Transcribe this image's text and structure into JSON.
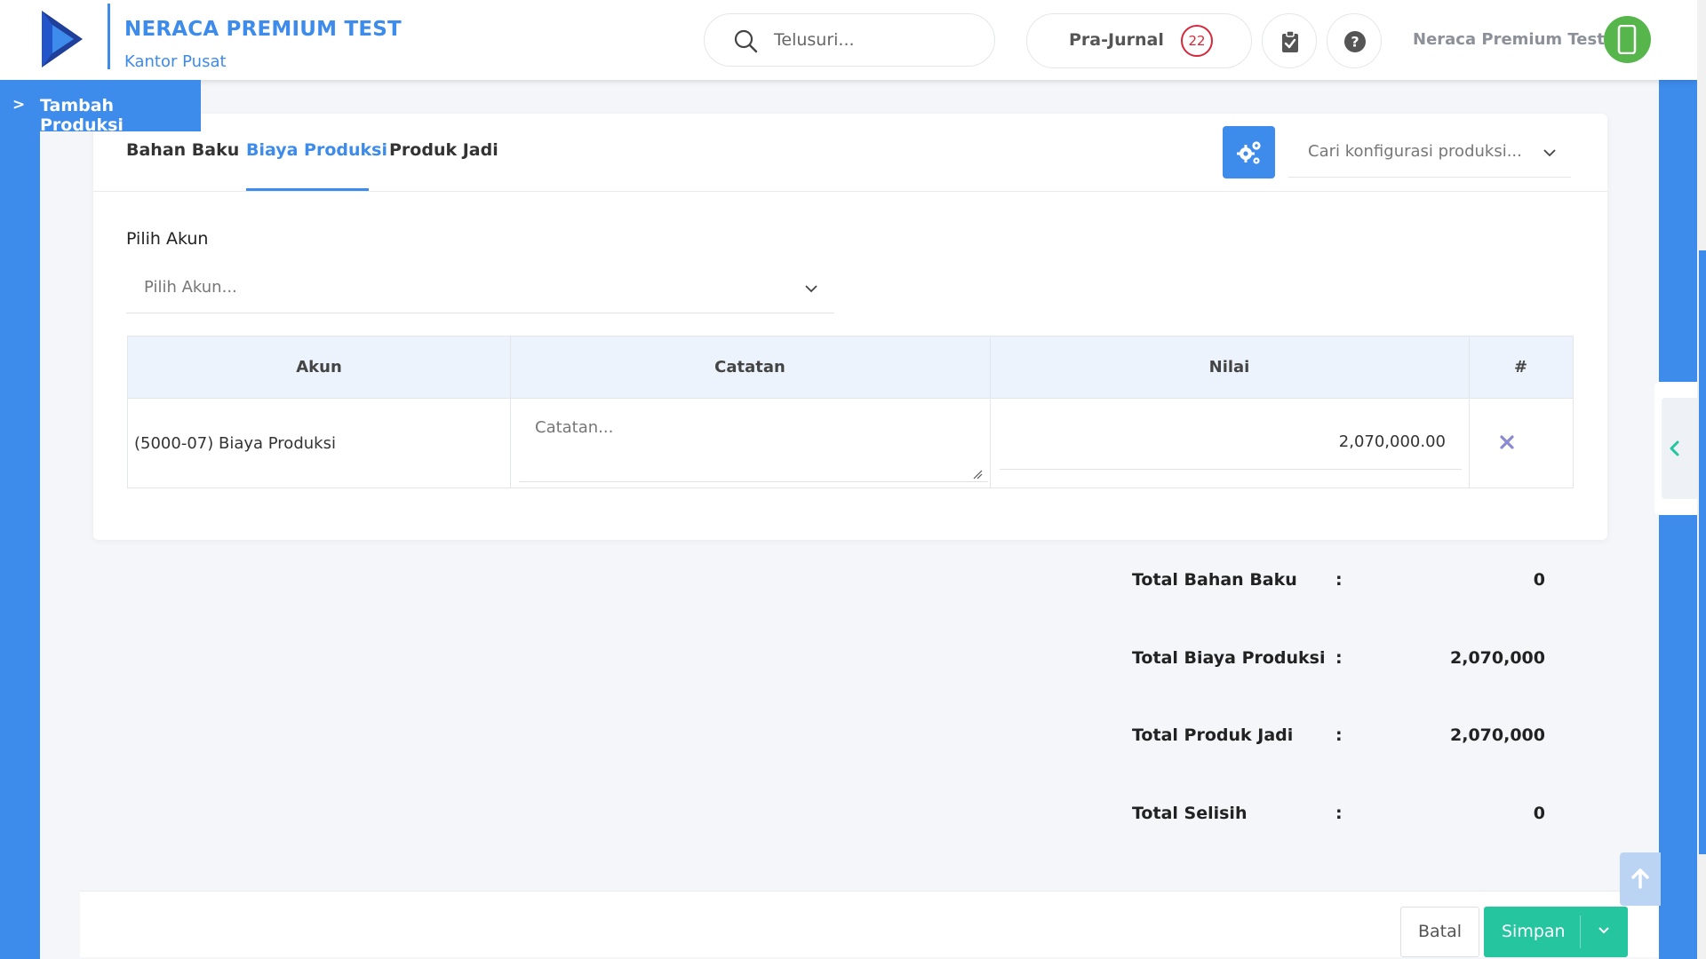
{
  "header": {
    "company_title": "NERACA PREMIUM TEST",
    "branch": "Kantor Pusat",
    "search_placeholder": "Telusuri...",
    "prajurnal_label": "Pra-Jurnal",
    "prajurnal_count": "22",
    "user_name": "Neraca Premium Test"
  },
  "page_tag": {
    "chevron": ">",
    "title": "Tambah Produksi"
  },
  "tabs": [
    {
      "label": "Bahan Baku",
      "active": false
    },
    {
      "label": "Biaya Produksi",
      "active": true
    },
    {
      "label": "Produk Jadi",
      "active": false
    }
  ],
  "config": {
    "search_placeholder": "Cari konfigurasi produksi..."
  },
  "form": {
    "pilih_akun_label": "Pilih Akun",
    "pilih_akun_placeholder": "Pilih Akun..."
  },
  "table": {
    "columns": [
      "Akun",
      "Catatan",
      "Nilai",
      "#"
    ],
    "rows": [
      {
        "akun": "(5000-07) Biaya Produksi",
        "catatan_placeholder": "Catatan...",
        "nilai": "2,070,000.00"
      }
    ]
  },
  "totals": [
    {
      "label": "Total Bahan Baku",
      "colon": ":",
      "value": "0"
    },
    {
      "label": "Total Biaya Produksi",
      "colon": ":",
      "value": "2,070,000"
    },
    {
      "label": "Total Produk Jadi",
      "colon": ":",
      "value": "2,070,000"
    },
    {
      "label": "Total Selisih",
      "colon": ":",
      "value": "0"
    }
  ],
  "footer": {
    "cancel_label": "Batal",
    "save_label": "Simpan"
  },
  "colors": {
    "primary": "#3d8beb",
    "success": "#25c5a0",
    "danger": "#d5283e",
    "avatar": "#56b64b"
  },
  "icons": {
    "logo": "brand-logo-icon",
    "search": "search-icon",
    "clipboard": "clipboard-check-icon",
    "help": "question-circle-icon",
    "avatar": "mobile-phone-icon",
    "config": "gears-icon",
    "delete": "close-icon",
    "scroll_top": "arrow-up-icon",
    "panel_toggle": "chevron-left-icon"
  }
}
